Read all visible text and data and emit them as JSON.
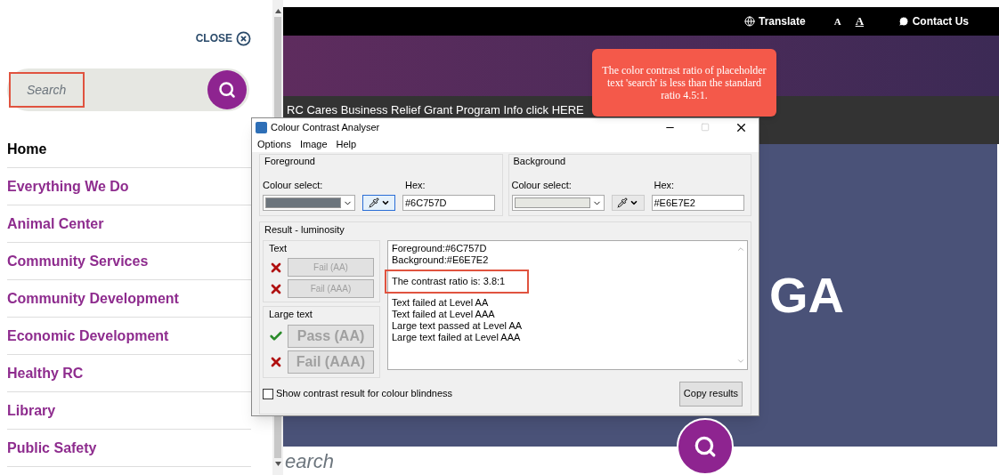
{
  "sidebar": {
    "close_label": "CLOSE",
    "search": {
      "placeholder": "Search"
    },
    "nav": [
      {
        "label": "Home",
        "selected": true
      },
      {
        "label": "Everything We Do",
        "selected": false
      },
      {
        "label": "Animal Center",
        "selected": false
      },
      {
        "label": "Community Services",
        "selected": false
      },
      {
        "label": "Community Development",
        "selected": false
      },
      {
        "label": "Economic Development",
        "selected": false
      },
      {
        "label": "Healthy RC",
        "selected": false
      },
      {
        "label": "Library",
        "selected": false
      },
      {
        "label": "Public Safety",
        "selected": false
      }
    ]
  },
  "site": {
    "top_links": [
      {
        "label": "Translate",
        "kind": "translate"
      },
      {
        "label": "A",
        "kind": "font_smaller"
      },
      {
        "label": "A",
        "kind": "font_larger"
      },
      {
        "label": "Contact Us",
        "kind": "contact"
      }
    ],
    "banner": "RC Cares Business Relief Grant Program Info click HERE",
    "hero_text": "GA",
    "search": {
      "placeholder": "earch"
    }
  },
  "callout": "The color contrast ratio of placeholder text 'search' is less than the standard ratio 4.5:1.",
  "dialog": {
    "title": "Colour Contrast Analyser",
    "menu": [
      "Options",
      "Image",
      "Help"
    ],
    "panels": [
      {
        "legend": "Foreground",
        "colour_select_label": "Colour select:",
        "hex_label": "Hex:",
        "hex": "#6C757D",
        "picker_selected": true
      },
      {
        "legend": "Background",
        "colour_select_label": "Colour select:",
        "hex_label": "Hex:",
        "hex": "#E6E7E2",
        "picker_selected": false
      }
    ],
    "result_legend": "Result - luminosity",
    "groups": [
      {
        "legend": "Text",
        "large": false,
        "results": [
          {
            "label": "Fail (AA)",
            "passed": false
          },
          {
            "label": "Fail (AAA)",
            "passed": false
          }
        ]
      },
      {
        "legend": "Large text",
        "large": true,
        "results": [
          {
            "label": "Pass (AA)",
            "passed": true
          },
          {
            "label": "Fail (AAA)",
            "passed": false
          }
        ]
      }
    ],
    "log": [
      {
        "text": "Foreground:#6C757D",
        "kind": "line"
      },
      {
        "text": "Background:#E6E7E2",
        "kind": "line"
      },
      {
        "text": "The contrast ratio is: 3.8:1",
        "kind": "highlight"
      },
      {
        "text": "Text failed at Level AA",
        "kind": "line"
      },
      {
        "text": "Text failed at Level AAA",
        "kind": "line"
      },
      {
        "text": "Large text passed at Level AA",
        "kind": "line"
      },
      {
        "text": "Large text failed at Level AAA",
        "kind": "line"
      }
    ],
    "blindness": {
      "label": "Show contrast result for colour blindness",
      "checked": false
    },
    "copy_button": "Copy results"
  }
}
